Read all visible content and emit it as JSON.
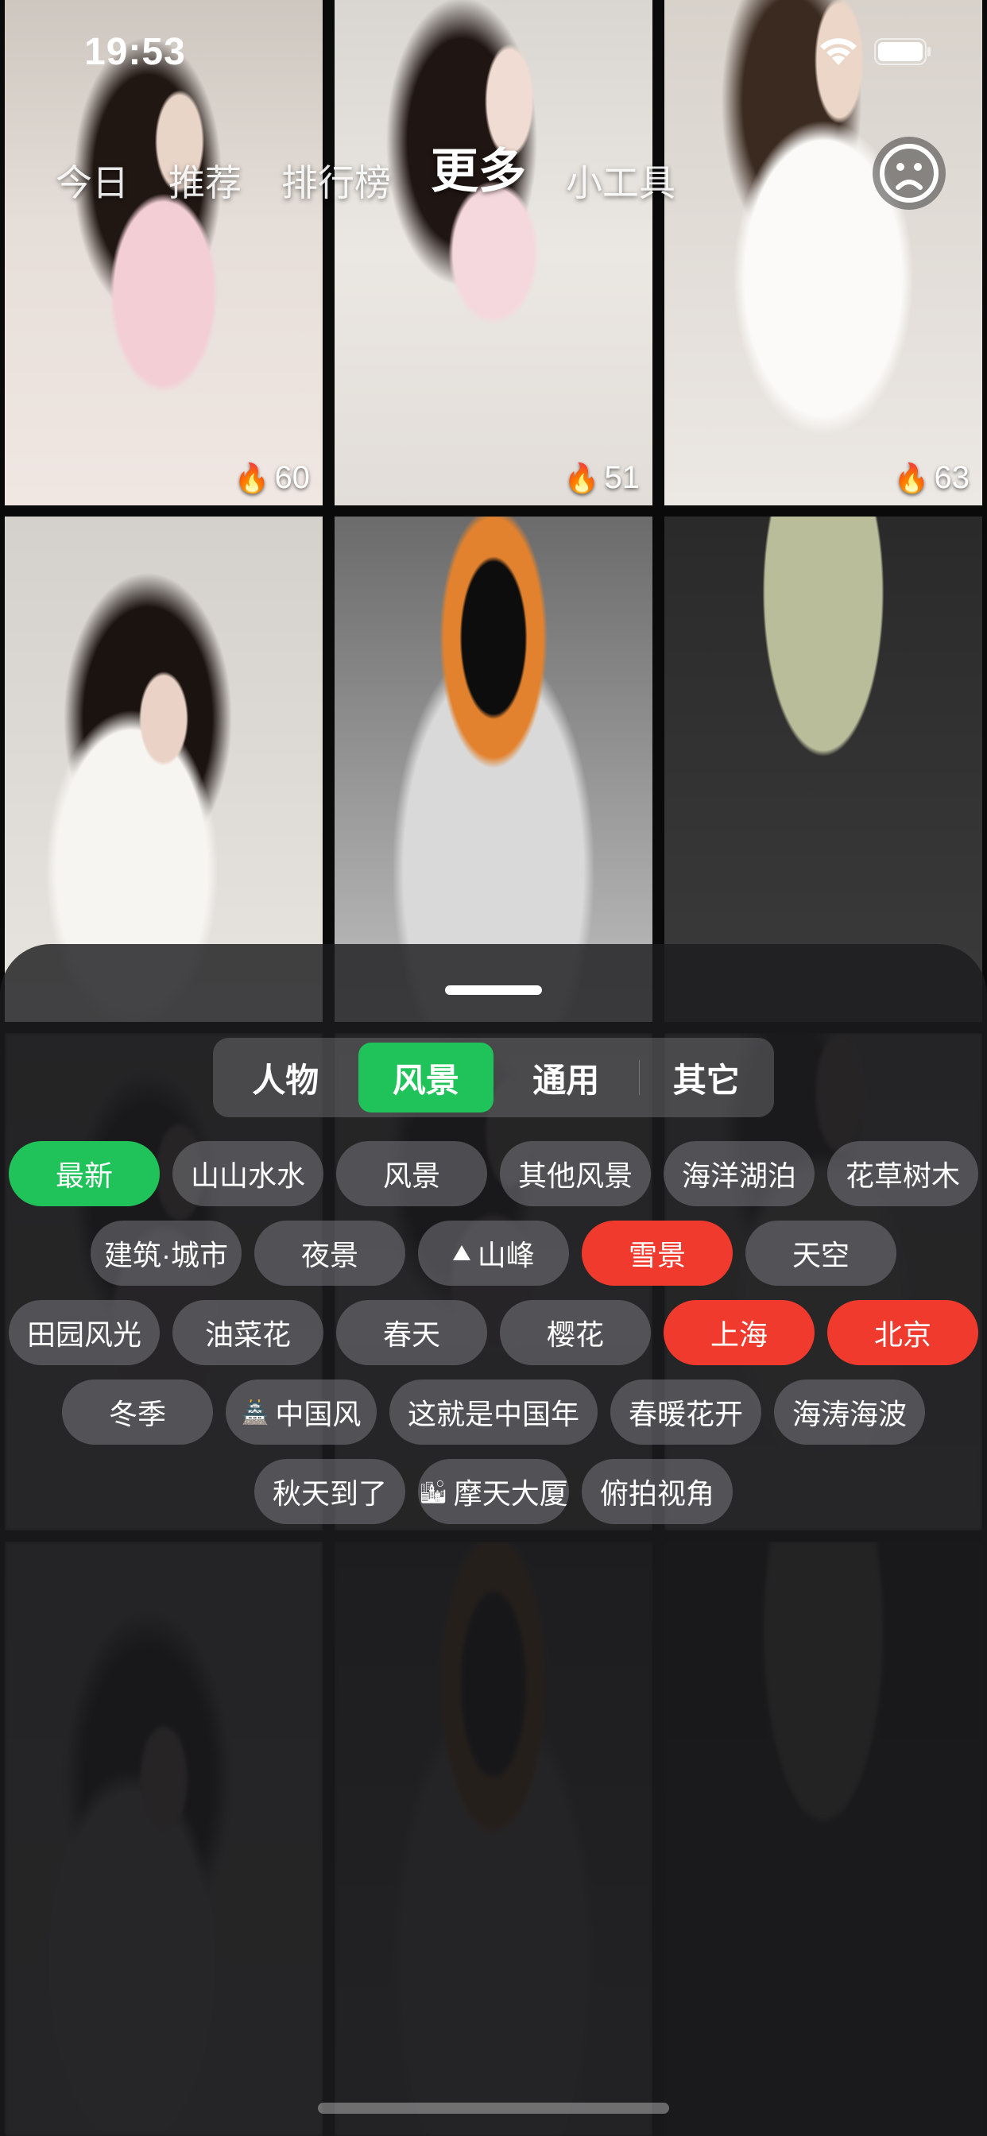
{
  "status_bar": {
    "time": "19:53"
  },
  "nav": {
    "tabs": [
      "今日",
      "推荐",
      "排行榜",
      "更多",
      "小工具"
    ],
    "active": "更多"
  },
  "wallpapers": [
    {
      "heat": "60",
      "style": "photo1"
    },
    {
      "heat": "51",
      "style": "photo2"
    },
    {
      "heat": "63",
      "style": "photo3"
    },
    {
      "heat": "",
      "style": "photo4"
    },
    {
      "heat": "",
      "style": "photo5"
    },
    {
      "heat": "",
      "style": "photo6"
    }
  ],
  "sheet": {
    "segments": [
      "人物",
      "风景",
      "通用",
      "其它"
    ],
    "active_segment": "风景",
    "chip_rows": [
      [
        {
          "label": "最新",
          "state": "green"
        },
        {
          "label": "山山水水",
          "state": ""
        },
        {
          "label": "风景",
          "state": ""
        },
        {
          "label": "其他风景",
          "state": ""
        },
        {
          "label": "海洋湖泊",
          "state": ""
        },
        {
          "label": "花草树木",
          "state": ""
        }
      ],
      [
        {
          "label": "建筑·城市",
          "state": ""
        },
        {
          "label": "夜景",
          "state": ""
        },
        {
          "label": "山峰",
          "state": "",
          "icon": "⛰"
        },
        {
          "label": "雪景",
          "state": "red"
        },
        {
          "label": "天空",
          "state": ""
        }
      ],
      [
        {
          "label": "田园风光",
          "state": ""
        },
        {
          "label": "油菜花",
          "state": ""
        },
        {
          "label": "春天",
          "state": ""
        },
        {
          "label": "樱花",
          "state": ""
        },
        {
          "label": "上海",
          "state": "red"
        },
        {
          "label": "北京",
          "state": "red"
        }
      ],
      [
        {
          "label": "冬季",
          "state": ""
        },
        {
          "label": "中国风",
          "state": "",
          "icon": "🏯"
        },
        {
          "label": "这就是中国年",
          "state": "",
          "size": "wider"
        },
        {
          "label": "春暖花开",
          "state": ""
        },
        {
          "label": "海涛海波",
          "state": ""
        }
      ],
      [
        {
          "label": "秋天到了",
          "state": ""
        },
        {
          "label": "摩天大厦",
          "state": "",
          "icon": "🏙"
        },
        {
          "label": "俯拍视角",
          "state": ""
        }
      ]
    ]
  },
  "colors": {
    "accent_green": "#1fc35a",
    "accent_red": "#f03a2e"
  }
}
